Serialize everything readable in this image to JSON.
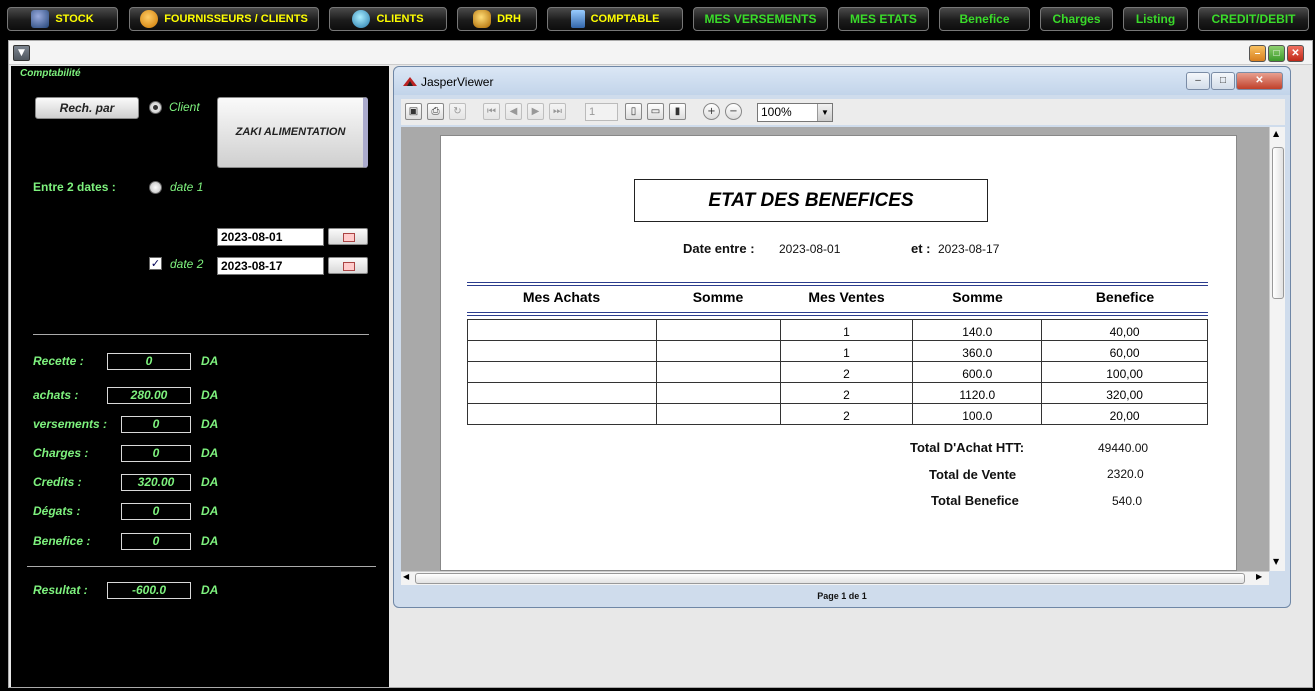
{
  "topbar": {
    "stock": "STOCK",
    "fournisseurs": "FOURNISSEURS / CLIENTS",
    "clients": "CLIENTS",
    "drh": "DRH",
    "comptable": "COMPTABLE",
    "versements": "MES VERSEMENTS",
    "etats": "MES ETATS",
    "benefice": "Benefice",
    "charges": "Charges",
    "listing": "Listing",
    "credit": "CREDIT/DEBIT"
  },
  "left": {
    "title": "Comptabilité",
    "rech_par": "Rech. par",
    "client_label": "Client",
    "client_name": "ZAKI ALIMENTATION",
    "entre_dates": "Entre 2 dates :",
    "date1_label": "date 1",
    "date2_label": "date 2",
    "date1_value": "2023-08-01",
    "date2_value": "2023-08-17",
    "currency": "DA",
    "rows": [
      {
        "label": "Recette :",
        "value": "0"
      },
      {
        "label": "achats :",
        "value": "280.00"
      },
      {
        "label": "versements :",
        "value": "0"
      },
      {
        "label": "Charges :",
        "value": "0"
      },
      {
        "label": "Credits :",
        "value": "320.00"
      },
      {
        "label": "Dégats  :",
        "value": "0"
      },
      {
        "label": "Benefice :",
        "value": "0"
      }
    ],
    "resultat_label": "Resultat :",
    "resultat_value": "-600.0"
  },
  "viewer": {
    "title": "JasperViewer",
    "page_number": "1",
    "zoom": "100%",
    "status": "Page 1 de 1"
  },
  "report": {
    "title": "ETAT DES BENEFICES",
    "date_entre_label": "Date entre :",
    "date_from": "2023-08-01",
    "et_label": "et :",
    "date_to": "2023-08-17",
    "headers": [
      "Mes Achats",
      "Somme",
      "Mes Ventes",
      "Somme",
      "Benefice"
    ],
    "rows": [
      [
        "",
        "",
        "1",
        "140.0",
        "40,00"
      ],
      [
        "",
        "",
        "1",
        "360.0",
        "60,00"
      ],
      [
        "",
        "",
        "2",
        "600.0",
        "100,00"
      ],
      [
        "",
        "",
        "2",
        "1120.0",
        "320,00"
      ],
      [
        "",
        "",
        "2",
        "100.0",
        "20,00"
      ]
    ],
    "total_achat_label": "Total D'Achat HTT:",
    "total_achat": "49440.00",
    "total_vente_label": "Total de Vente",
    "total_vente": "2320.0",
    "total_benefice_label": "Total Benefice",
    "total_benefice": "540.0"
  }
}
